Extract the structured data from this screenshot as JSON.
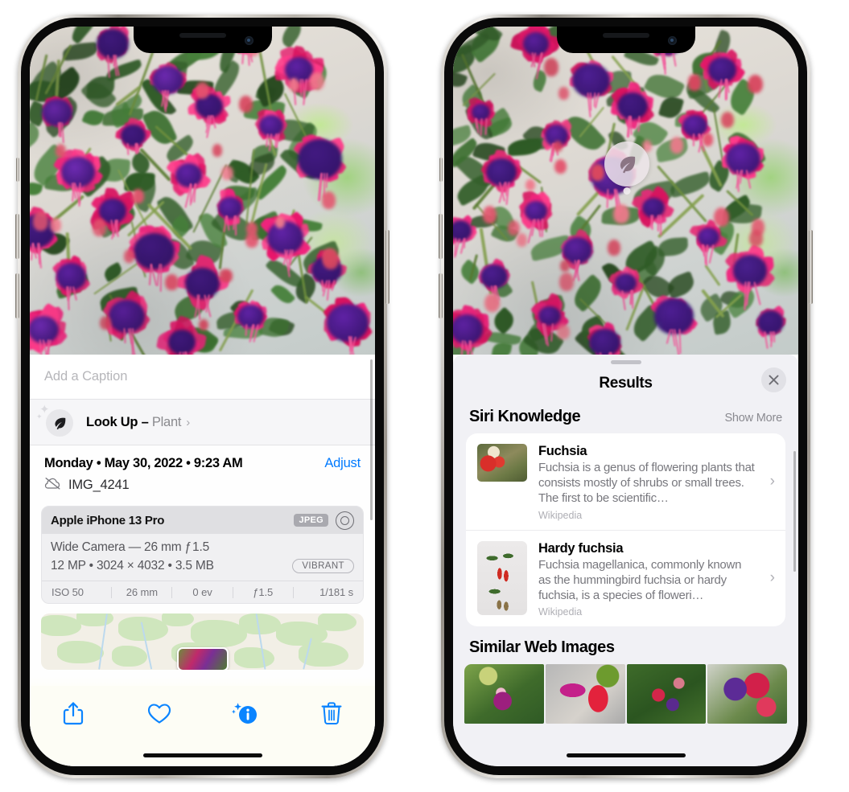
{
  "page": {
    "background": "#ffffff"
  },
  "colors": {
    "accent": "#007aff",
    "sheet_bg": "#f1f1f5",
    "card_bg": "#ffffff",
    "toolbar_bg": "#fdfdf5"
  },
  "left_phone": {
    "caption": {
      "placeholder": "Add a Caption",
      "value": ""
    },
    "lookup": {
      "icon": "leaf-icon",
      "sparkle_icon": "sparkles-icon",
      "label": "Look Up –",
      "subject": "Plant",
      "chevron": "›"
    },
    "metadata": {
      "date_line": "Monday • May 30, 2022 • 9:23 AM",
      "adjust_label": "Adjust",
      "cloud_icon": "cloud-slash-icon",
      "filename": "IMG_4241"
    },
    "camera_card": {
      "model": "Apple iPhone 13 Pro",
      "format_chip": "JPEG",
      "lens_icon": "lens-icon",
      "lens_line": "Wide Camera — 26 mm ƒ 1.5",
      "size_line": "12 MP • 3024 × 4032 • 3.5 MB",
      "style_chip": "VIBRANT",
      "exif": [
        "ISO 50",
        "26 mm",
        "0 ev",
        "ƒ1.5",
        "1/181 s"
      ]
    },
    "toolbar": [
      {
        "name": "share-button",
        "icon": "share-icon"
      },
      {
        "name": "favorite-button",
        "icon": "heart-icon"
      },
      {
        "name": "info-button",
        "icon": "info-sparkle-icon"
      },
      {
        "name": "delete-button",
        "icon": "trash-icon"
      }
    ]
  },
  "right_phone": {
    "visual_look_up_badge": {
      "icon": "leaf-icon"
    },
    "sheet": {
      "title": "Results",
      "close_icon": "close-icon",
      "sections": [
        {
          "title": "Siri Knowledge",
          "action": "Show More",
          "items": [
            {
              "title": "Fuchsia",
              "description": "Fuchsia is a genus of flowering plants that consists mostly of shrubs or small trees. The first to be scientific…",
              "source": "Wikipedia",
              "thumb": "fuchsia-red-flowers-thumb",
              "chevron": "›"
            },
            {
              "title": "Hardy fuchsia",
              "description": "Fuchsia magellanica, commonly known as the hummingbird fuchsia or hardy fuchsia, is a species of floweri…",
              "source": "Wikipedia",
              "thumb": "hardy-fuchsia-specimen-thumb",
              "chevron": "›"
            }
          ]
        },
        {
          "title": "Similar Web Images",
          "items": [
            {
              "thumb": "web-image-1-pink-white-fuchsia"
            },
            {
              "thumb": "web-image-2-red-fuchsia-closeup"
            },
            {
              "thumb": "web-image-3-fuchsia-bush"
            },
            {
              "thumb": "web-image-4-purple-red-fuchsia"
            }
          ]
        }
      ]
    }
  }
}
